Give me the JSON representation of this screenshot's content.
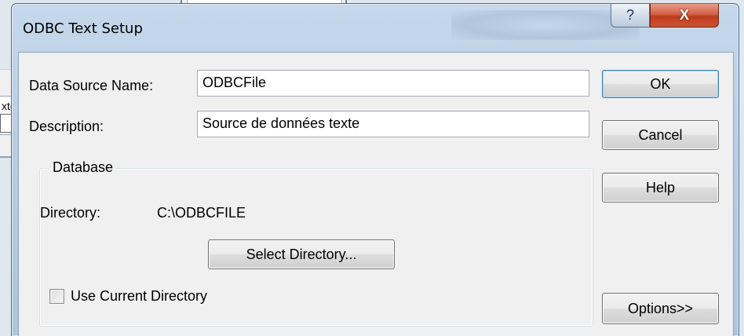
{
  "background": {
    "left_row1": "xte",
    "left_row2": "□ a"
  },
  "dialog": {
    "title": "ODBC Text Setup",
    "help_glyph": "?",
    "close_glyph": "X"
  },
  "form": {
    "dsn_label": "Data Source Name:",
    "dsn_value": "ODBCFile",
    "description_label": "Description:",
    "description_value": "Source de données texte"
  },
  "database": {
    "group_title": "Database",
    "directory_label": "Directory:",
    "directory_value": "C:\\ODBCFILE",
    "select_directory_label": "Select Directory...",
    "use_current_directory_label": "Use Current Directory",
    "use_current_directory_checked": false
  },
  "buttons": {
    "ok": "OK",
    "cancel": "Cancel",
    "help": "Help",
    "options": "Options>>"
  },
  "icons": {
    "help": "question-mark-icon",
    "close": "close-x-icon",
    "checkbox": "checkbox-icon"
  },
  "colors": {
    "frame_blue": "#b9cde3",
    "close_red": "#c9482a",
    "client_gray": "#f0f0f0",
    "default_button_border": "#3c7fb1"
  }
}
